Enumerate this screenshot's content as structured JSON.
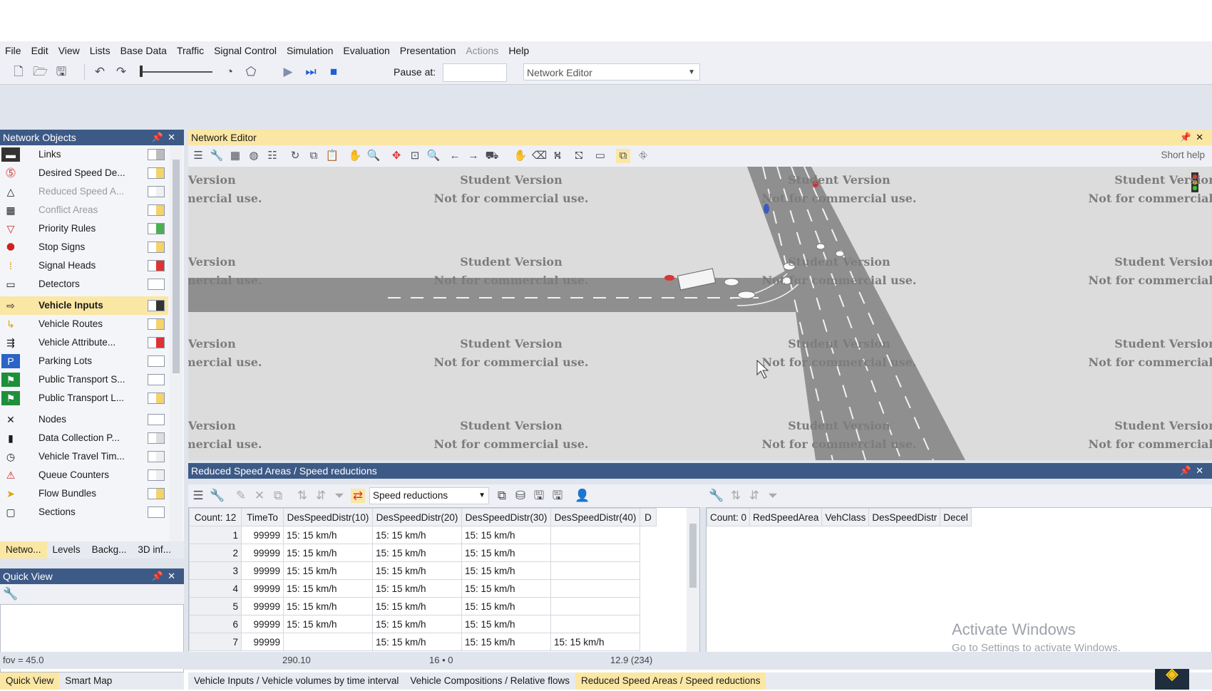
{
  "menu": [
    "File",
    "Edit",
    "View",
    "Lists",
    "Base Data",
    "Traffic",
    "Signal Control",
    "Simulation",
    "Evaluation",
    "Presentation",
    "Actions",
    "Help"
  ],
  "menu_disabled": [
    "Actions"
  ],
  "toolbar": {
    "pause_label": "Pause at:",
    "view_select": "Network Editor"
  },
  "network_objects": {
    "title": "Network Objects",
    "items": [
      {
        "label": "Links",
        "icon": "links-icon"
      },
      {
        "label": "Desired Speed De...",
        "icon": "speed-sign-icon"
      },
      {
        "label": "Reduced Speed A...",
        "icon": "reduced-speed-icon",
        "dim": true
      },
      {
        "label": "Conflict Areas",
        "icon": "conflict-area-icon",
        "dim": true
      },
      {
        "label": "Priority Rules",
        "icon": "yield-icon"
      },
      {
        "label": "Stop Signs",
        "icon": "stop-sign-icon"
      },
      {
        "label": "Signal Heads",
        "icon": "traffic-light-icon"
      },
      {
        "label": "Detectors",
        "icon": "detector-icon"
      },
      {
        "label": "Vehicle Inputs",
        "icon": "vehicle-input-icon",
        "selected": true
      },
      {
        "label": "Vehicle Routes",
        "icon": "vehicle-route-icon"
      },
      {
        "label": "Vehicle Attribute...",
        "icon": "vehicle-attribute-icon"
      },
      {
        "label": "Parking Lots",
        "icon": "parking-icon"
      },
      {
        "label": "Public Transport S...",
        "icon": "pt-stop-icon"
      },
      {
        "label": "Public Transport L...",
        "icon": "pt-line-icon"
      },
      {
        "label": "Nodes",
        "icon": "nodes-icon"
      },
      {
        "label": "Data Collection P...",
        "icon": "data-collection-icon"
      },
      {
        "label": "Vehicle Travel Tim...",
        "icon": "travel-time-icon"
      },
      {
        "label": "Queue Counters",
        "icon": "queue-counter-icon"
      },
      {
        "label": "Flow Bundles",
        "icon": "flow-bundle-icon"
      },
      {
        "label": "Sections",
        "icon": "sections-icon"
      }
    ],
    "tabs": [
      "Netwo...",
      "Levels",
      "Backg...",
      "3D inf..."
    ]
  },
  "quick_view": {
    "title": "Quick View",
    "tabs": [
      "Quick View",
      "Smart Map"
    ]
  },
  "network_editor": {
    "title": "Network Editor",
    "short_help": "Short help",
    "watermark_line1": "Student Version",
    "watermark_line2": "Not for commercial use."
  },
  "bottom": {
    "title": "Reduced Speed Areas / Speed reductions",
    "dropdown": "Speed reductions",
    "left_grid": {
      "count_header": "Count: 12",
      "columns": [
        "TimeTo",
        "DesSpeedDistr(10)",
        "DesSpeedDistr(20)",
        "DesSpeedDistr(30)",
        "DesSpeedDistr(40)",
        "D"
      ],
      "rows": [
        [
          "1",
          "99999",
          "15: 15 km/h",
          "15: 15 km/h",
          "15: 15 km/h",
          ""
        ],
        [
          "2",
          "99999",
          "15: 15 km/h",
          "15: 15 km/h",
          "15: 15 km/h",
          ""
        ],
        [
          "3",
          "99999",
          "15: 15 km/h",
          "15: 15 km/h",
          "15: 15 km/h",
          ""
        ],
        [
          "4",
          "99999",
          "15: 15 km/h",
          "15: 15 km/h",
          "15: 15 km/h",
          ""
        ],
        [
          "5",
          "99999",
          "15: 15 km/h",
          "15: 15 km/h",
          "15: 15 km/h",
          ""
        ],
        [
          "6",
          "99999",
          "15: 15 km/h",
          "15: 15 km/h",
          "15: 15 km/h",
          ""
        ],
        [
          "7",
          "99999",
          "",
          "15: 15 km/h",
          "15: 15 km/h",
          "15: 15 km/h"
        ]
      ]
    },
    "right_grid": {
      "count_header": "Count: 0",
      "columns": [
        "RedSpeedArea",
        "VehClass",
        "DesSpeedDistr",
        "Decel"
      ]
    },
    "tabs": [
      "Vehicle Inputs / Vehicle volumes by time interval",
      "Vehicle Compositions / Relative flows",
      "Reduced Speed Areas / Speed reductions"
    ],
    "activate_windows": {
      "line1": "Activate Windows",
      "line2": "Go to Settings to activate Windows."
    }
  },
  "status": {
    "fov": "fov = 45.0",
    "coord": "290.10",
    "count": "16 • 0",
    "pos": "12.9 (234)"
  },
  "colors": {
    "panel_header": "#3d5a86",
    "selection": "#fbe7a4",
    "road": "#8f8f8f",
    "canvas": "#dcdcdc"
  }
}
